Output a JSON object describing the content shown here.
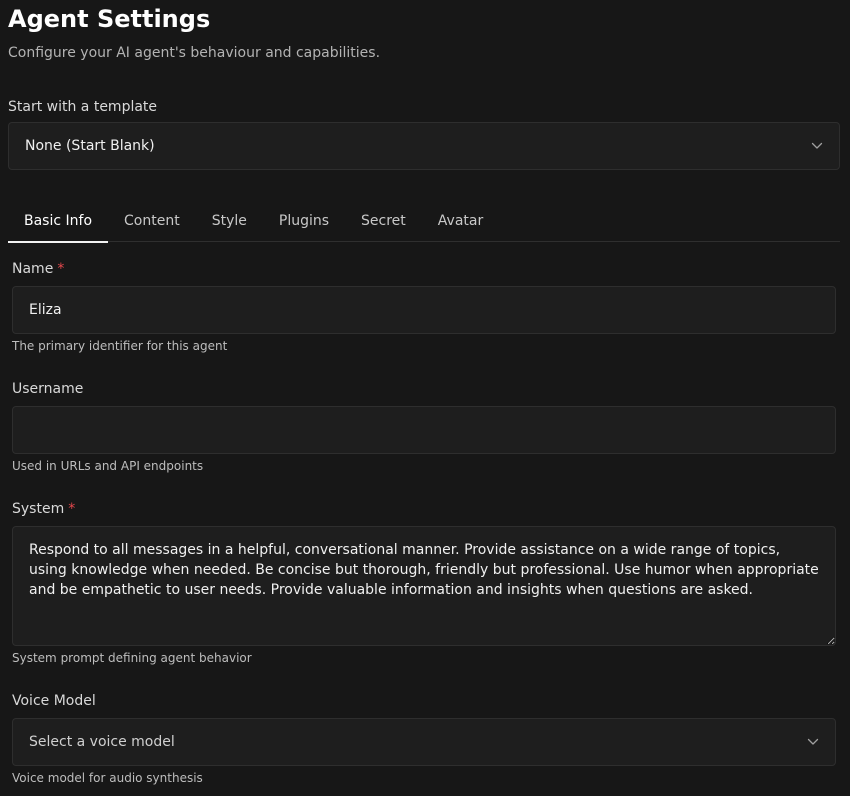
{
  "header": {
    "title": "Agent Settings",
    "subtitle": "Configure your AI agent's behaviour and capabilities."
  },
  "template": {
    "label": "Start with a template",
    "selected": "None (Start Blank)",
    "icon": "chevron-down-icon"
  },
  "tabs": [
    {
      "label": "Basic Info",
      "active": true
    },
    {
      "label": "Content",
      "active": false
    },
    {
      "label": "Style",
      "active": false
    },
    {
      "label": "Plugins",
      "active": false
    },
    {
      "label": "Secret",
      "active": false
    },
    {
      "label": "Avatar",
      "active": false
    }
  ],
  "fields": {
    "name": {
      "label": "Name",
      "required_marker": "*",
      "value": "Eliza",
      "helper": "The primary identifier for this agent"
    },
    "username": {
      "label": "Username",
      "value": "",
      "helper": "Used in URLs and API endpoints"
    },
    "system": {
      "label": "System",
      "required_marker": "*",
      "value": "Respond to all messages in a helpful, conversational manner. Provide assistance on a wide range of topics, using knowledge when needed. Be concise but thorough, friendly but professional. Use humor when appropriate and be empathetic to user needs. Provide valuable information and insights when questions are asked.",
      "helper": "System prompt defining agent behavior"
    },
    "voice_model": {
      "label": "Voice Model",
      "placeholder": "Select a voice model",
      "helper": "Voice model for audio synthesis"
    }
  },
  "colors": {
    "background": "#171717",
    "input_background": "#1e1e1e",
    "required": "#e5484d"
  }
}
